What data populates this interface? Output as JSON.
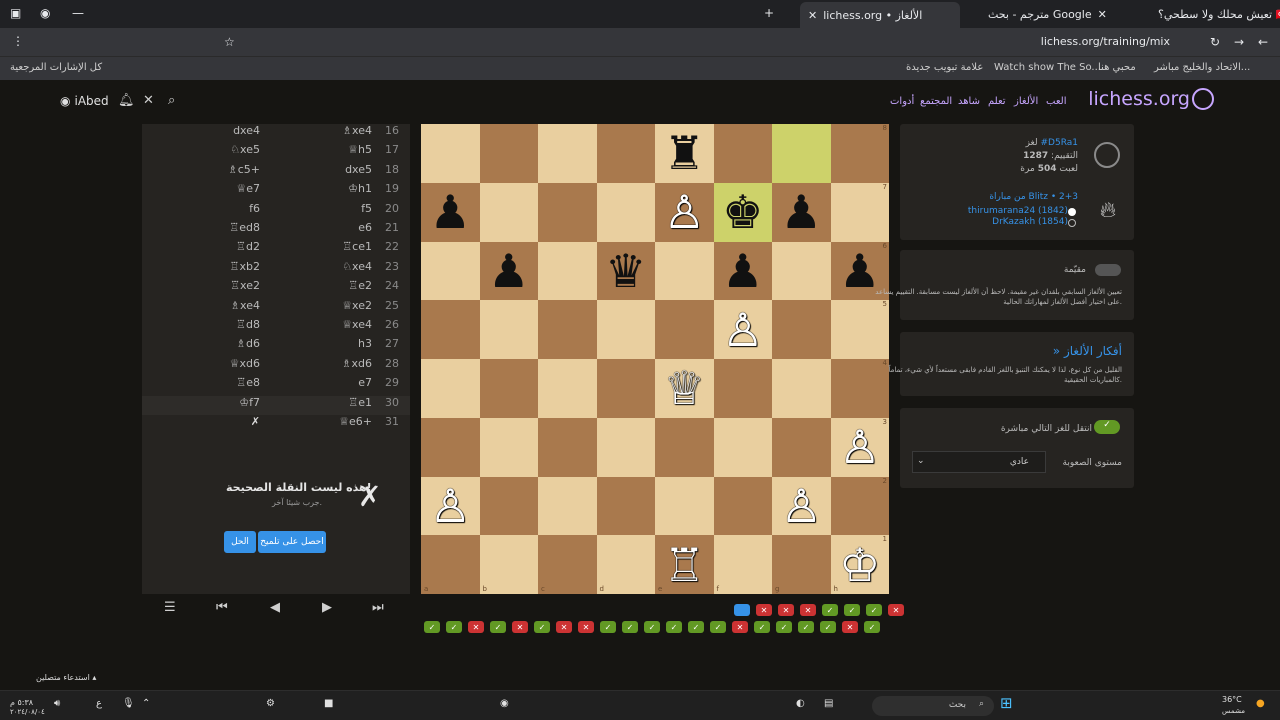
{
  "browser": {
    "tabs": [
      {
        "label": "تعيش محلك ولا سطحي؟ 🇹🇷",
        "active": false
      },
      {
        "label": "مترجم - بحث Google",
        "active": false
      },
      {
        "label": "lichess.org • الألغاز",
        "active": true
      }
    ],
    "url": "lichess.org/training/mix",
    "bookmarks": [
      "كل الإشارات المرجعية",
      "علامة تبويب جديدة",
      "Watch show The So...",
      "محبي هنا",
      "الاتحاد والخليج مباشر..."
    ]
  },
  "header": {
    "logo": "lichess.org",
    "nav": [
      "العب",
      "الألغاز",
      "تعلم",
      "شاهد",
      "المجتمع",
      "أدوات"
    ],
    "username": "iAbed"
  },
  "moves": [
    {
      "n": "16",
      "w": "♗xe4",
      "b": "dxe4"
    },
    {
      "n": "17",
      "w": "♕h5",
      "b": "♘xe5"
    },
    {
      "n": "18",
      "w": "dxe5",
      "b": "♗c5+"
    },
    {
      "n": "19",
      "w": "♔h1",
      "b": "♕e7"
    },
    {
      "n": "20",
      "w": "f5",
      "b": "f6"
    },
    {
      "n": "21",
      "w": "e6",
      "b": "♖ed8"
    },
    {
      "n": "22",
      "w": "♖ce1",
      "b": "♖d2"
    },
    {
      "n": "23",
      "w": "♘xe4",
      "b": "♖xb2"
    },
    {
      "n": "24",
      "w": "♖e2",
      "b": "♖xe2"
    },
    {
      "n": "25",
      "w": "♕xe2",
      "b": "♗xe4"
    },
    {
      "n": "26",
      "w": "♕xe4",
      "b": "♖d8"
    },
    {
      "n": "27",
      "w": "h3",
      "b": "♗d6"
    },
    {
      "n": "28",
      "w": "♗xd6",
      "b": "♕xd6"
    },
    {
      "n": "29",
      "w": "e7",
      "b": "♖e8"
    },
    {
      "n": "30",
      "w": "♖e1",
      "b": "♔f7"
    },
    {
      "n": "31",
      "w": "♕e6+",
      "b": "✗"
    }
  ],
  "feedback": {
    "title": "هذه ليست النقلة الصحيحة!",
    "subtitle": "جرب شيئا آخر.",
    "x_mark": "✗",
    "solution_button": "الحل",
    "hint_button": "احصل على تلميح"
  },
  "controls": {
    "menu": "☰",
    "first": "⏮",
    "prev": "◀",
    "next": "▶",
    "last": "⏭"
  },
  "board": {
    "rows": [
      [
        "",
        "",
        "",
        "",
        "♜",
        "",
        "",
        ""
      ],
      [
        "♟",
        "",
        "",
        "",
        "♙",
        "♚",
        "♟",
        ""
      ],
      [
        "",
        "♟",
        "",
        "♛",
        "",
        "♟",
        "",
        "♟"
      ],
      [
        "",
        "",
        "",
        "",
        "",
        "♙",
        "",
        ""
      ],
      [
        "",
        "",
        "",
        "",
        "♕",
        "",
        "",
        ""
      ],
      [
        "",
        "",
        "",
        "",
        "",
        "",
        "",
        "♙"
      ],
      [
        "♙",
        "",
        "",
        "",
        "",
        "",
        "♙",
        ""
      ],
      [
        "",
        "",
        "",
        "",
        "♖",
        "",
        "",
        "♔"
      ]
    ],
    "files": [
      "a",
      "b",
      "c",
      "d",
      "e",
      "f",
      "g",
      "h"
    ],
    "ranks": [
      "8",
      "7",
      "6",
      "5",
      "4",
      "3",
      "2",
      "1"
    ]
  },
  "results_row1": [
    "cur",
    "ko",
    "ko",
    "ko",
    "ok",
    "ok",
    "ok",
    "ko"
  ],
  "results_row2": [
    "ok",
    "ok",
    "ko",
    "ok",
    "ko",
    "ok",
    "ko",
    "ko",
    "ok",
    "ok",
    "ok",
    "ok",
    "ok",
    "ok",
    "ko",
    "ok",
    "ok",
    "ok",
    "ok",
    "ko",
    "ok"
  ],
  "puzzle_info": {
    "puzzle_label": "لغز",
    "puzzle_id": "#D5Ra1",
    "rating_label": "التقييم:",
    "rating": "1287",
    "played_prefix": "لعبت",
    "played_count": "504",
    "played_suffix": "مرة",
    "from_game": "من مباراة Blitz • 2+3",
    "white_player": "thirumarana24 (1842)",
    "black_player": "DrKazakh (1854)"
  },
  "rated": {
    "label": "مقيّمة",
    "text1": "تعيين الألغاز السابقي بلقدان غير مقيمة. لاحظ أن الألغاز ليست مسابقة. التقييم يساعد",
    "text2": "على اختيار أفضل الألغاز لمهاراتك الحالية."
  },
  "themes": {
    "title": "» أفكار الألغاز",
    "text1": "القليل من كل نوع، لذا لا يمكنك التنبؤ باللغز القادم فابقى مستعداً لأي شيء، تماماً",
    "text2": "كالمباريات الحقيقية."
  },
  "settings": {
    "jump_label": "انتقل للغز التالي مباشرة",
    "difficulty_label": "مستوى الصعوبة",
    "difficulty_value": "عادي"
  },
  "taskbar": {
    "weather_temp": "36°C",
    "weather_desc": "مشمس",
    "search": "بحث",
    "time": "٥:٣٨ م",
    "date": "٢٠٢٤/٠٨/٠٤",
    "lang": "ع",
    "notification": "استدعاء متصلين"
  }
}
